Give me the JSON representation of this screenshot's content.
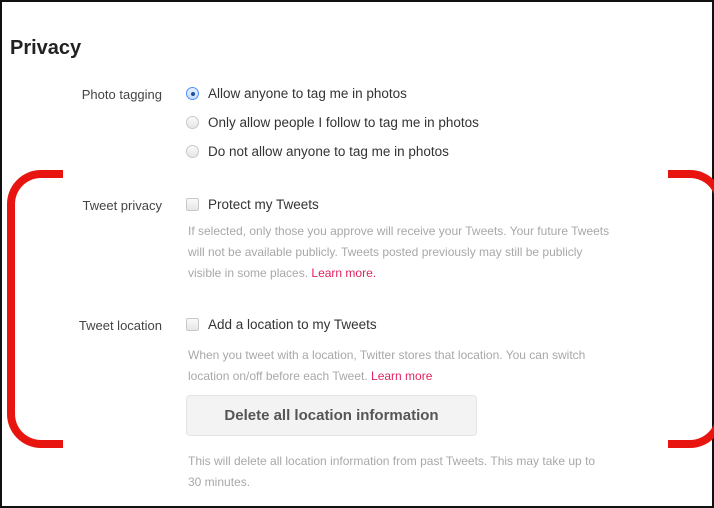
{
  "section_title": "Privacy",
  "photo_tagging": {
    "label": "Photo tagging",
    "options": [
      {
        "label": "Allow anyone to tag me in photos",
        "selected": true
      },
      {
        "label": "Only allow people I follow to tag me in photos",
        "selected": false
      },
      {
        "label": "Do not allow anyone to tag me in photos",
        "selected": false
      }
    ]
  },
  "tweet_privacy": {
    "label": "Tweet privacy",
    "checkbox_label": "Protect my Tweets",
    "checked": false,
    "help_line1": "If selected, only those you approve will receive your Tweets. Your future Tweets",
    "help_line2": "will not be available publicly. Tweets posted previously may still be publicly",
    "help_line3": "visible in some places.",
    "learn_more": "Learn more."
  },
  "tweet_location": {
    "label": "Tweet location",
    "checkbox_label": "Add a location to my Tweets",
    "checked": false,
    "help_line1": "When you tweet with a location, Twitter stores that location. You can switch",
    "help_line2": "location on/off before each Tweet.",
    "learn_more": "Learn more",
    "delete_button": "Delete all location information",
    "delete_help_line1": "This will delete all location information from past Tweets. This may take up to",
    "delete_help_line2": "30 minutes."
  },
  "colors": {
    "annotation_bracket": "#e8140f",
    "link": "#e0245e",
    "radio_selected": "#4d90fe"
  }
}
